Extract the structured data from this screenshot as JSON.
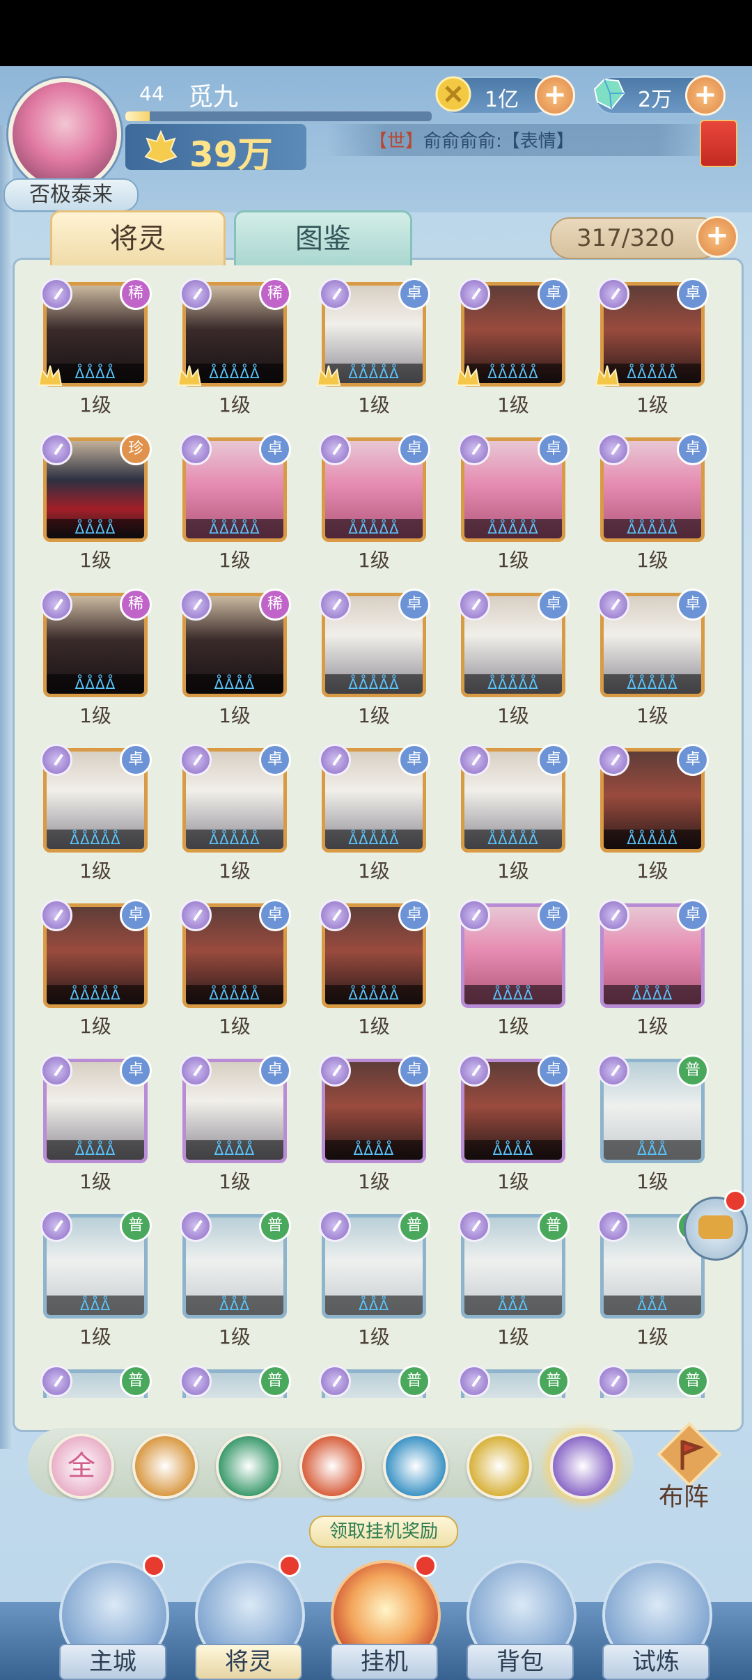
{
  "player": {
    "level": "44",
    "name": "觅九",
    "title": "否极泰来",
    "power": "39万",
    "exp_progress": 0.08
  },
  "resources": {
    "gold": "1亿",
    "gem": "2万"
  },
  "chat": {
    "channel": "【世】",
    "text": "俞俞俞俞:【表情】"
  },
  "tabs": [
    {
      "label": "将灵",
      "active": true
    },
    {
      "label": "图鉴",
      "active": false
    }
  ],
  "capacity": "317/320",
  "cards": [
    {
      "rarity": "稀",
      "rclass": "rare",
      "frame": "gold",
      "tone": "dark",
      "stars": "ᐂᐂᐂᐂ",
      "level": "1级",
      "crown": true
    },
    {
      "rarity": "稀",
      "rclass": "rare",
      "frame": "gold",
      "tone": "dark",
      "stars": "ᐂᐂᐂᐂᐂ",
      "level": "1级",
      "crown": true
    },
    {
      "rarity": "卓",
      "rclass": "elite",
      "frame": "gold",
      "tone": "white",
      "stars": "ᐂᐂᐂᐂᐂ",
      "level": "1级",
      "crown": true
    },
    {
      "rarity": "卓",
      "rclass": "elite",
      "frame": "gold",
      "tone": "red",
      "stars": "ᐂᐂᐂᐂᐂ",
      "level": "1级",
      "crown": true
    },
    {
      "rarity": "卓",
      "rclass": "elite",
      "frame": "gold",
      "tone": "red",
      "stars": "ᐂᐂᐂᐂᐂ",
      "level": "1级",
      "crown": true
    },
    {
      "rarity": "珍",
      "rclass": "precious",
      "frame": "gold",
      "tone": "ninja",
      "stars": "ᐂᐂᐂᐂ",
      "level": "1级",
      "crown": false
    },
    {
      "rarity": "卓",
      "rclass": "elite",
      "frame": "gold",
      "tone": "pink",
      "stars": "ᐂᐂᐂᐂᐂ",
      "level": "1级",
      "crown": false
    },
    {
      "rarity": "卓",
      "rclass": "elite",
      "frame": "gold",
      "tone": "pink",
      "stars": "ᐂᐂᐂᐂᐂ",
      "level": "1级",
      "crown": false
    },
    {
      "rarity": "卓",
      "rclass": "elite",
      "frame": "gold",
      "tone": "pink",
      "stars": "ᐂᐂᐂᐂᐂ",
      "level": "1级",
      "crown": false
    },
    {
      "rarity": "卓",
      "rclass": "elite",
      "frame": "gold",
      "tone": "pink",
      "stars": "ᐂᐂᐂᐂᐂ",
      "level": "1级",
      "crown": false
    },
    {
      "rarity": "稀",
      "rclass": "rare",
      "frame": "gold",
      "tone": "dark",
      "stars": "ᐂᐂᐂᐂ",
      "level": "1级",
      "crown": false
    },
    {
      "rarity": "稀",
      "rclass": "rare",
      "frame": "gold",
      "tone": "dark",
      "stars": "ᐂᐂᐂᐂ",
      "level": "1级",
      "crown": false
    },
    {
      "rarity": "卓",
      "rclass": "elite",
      "frame": "gold",
      "tone": "white",
      "stars": "ᐂᐂᐂᐂᐂ",
      "level": "1级",
      "crown": false
    },
    {
      "rarity": "卓",
      "rclass": "elite",
      "frame": "gold",
      "tone": "white",
      "stars": "ᐂᐂᐂᐂᐂ",
      "level": "1级",
      "crown": false
    },
    {
      "rarity": "卓",
      "rclass": "elite",
      "frame": "gold",
      "tone": "white",
      "stars": "ᐂᐂᐂᐂᐂ",
      "level": "1级",
      "crown": false
    },
    {
      "rarity": "卓",
      "rclass": "elite",
      "frame": "gold",
      "tone": "white",
      "stars": "ᐂᐂᐂᐂᐂ",
      "level": "1级",
      "crown": false
    },
    {
      "rarity": "卓",
      "rclass": "elite",
      "frame": "gold",
      "tone": "white",
      "stars": "ᐂᐂᐂᐂᐂ",
      "level": "1级",
      "crown": false
    },
    {
      "rarity": "卓",
      "rclass": "elite",
      "frame": "gold",
      "tone": "white",
      "stars": "ᐂᐂᐂᐂᐂ",
      "level": "1级",
      "crown": false
    },
    {
      "rarity": "卓",
      "rclass": "elite",
      "frame": "gold",
      "tone": "white",
      "stars": "ᐂᐂᐂᐂᐂ",
      "level": "1级",
      "crown": false
    },
    {
      "rarity": "卓",
      "rclass": "elite",
      "frame": "gold",
      "tone": "red",
      "stars": "ᐂᐂᐂᐂᐂ",
      "level": "1级",
      "crown": false
    },
    {
      "rarity": "卓",
      "rclass": "elite",
      "frame": "gold",
      "tone": "red",
      "stars": "ᐂᐂᐂᐂᐂ",
      "level": "1级",
      "crown": false
    },
    {
      "rarity": "卓",
      "rclass": "elite",
      "frame": "gold",
      "tone": "red",
      "stars": "ᐂᐂᐂᐂᐂ",
      "level": "1级",
      "crown": false
    },
    {
      "rarity": "卓",
      "rclass": "elite",
      "frame": "gold",
      "tone": "red",
      "stars": "ᐂᐂᐂᐂᐂ",
      "level": "1级",
      "crown": false
    },
    {
      "rarity": "卓",
      "rclass": "elite",
      "frame": "purple",
      "tone": "pink",
      "stars": "ᐂᐂᐂᐂ",
      "level": "1级",
      "crown": false
    },
    {
      "rarity": "卓",
      "rclass": "elite",
      "frame": "purple",
      "tone": "pink",
      "stars": "ᐂᐂᐂᐂ",
      "level": "1级",
      "crown": false
    },
    {
      "rarity": "卓",
      "rclass": "elite",
      "frame": "purple",
      "tone": "white",
      "stars": "ᐂᐂᐂᐂ",
      "level": "1级",
      "crown": false
    },
    {
      "rarity": "卓",
      "rclass": "elite",
      "frame": "purple",
      "tone": "white",
      "stars": "ᐂᐂᐂᐂ",
      "level": "1级",
      "crown": false
    },
    {
      "rarity": "卓",
      "rclass": "elite",
      "frame": "purple",
      "tone": "red",
      "stars": "ᐂᐂᐂᐂ",
      "level": "1级",
      "crown": false
    },
    {
      "rarity": "卓",
      "rclass": "elite",
      "frame": "purple",
      "tone": "red",
      "stars": "ᐂᐂᐂᐂ",
      "level": "1级",
      "crown": false
    },
    {
      "rarity": "普",
      "rclass": "common",
      "frame": "blue",
      "tone": "pale",
      "stars": "ᐂᐂᐂ",
      "level": "1级",
      "crown": false
    },
    {
      "rarity": "普",
      "rclass": "common",
      "frame": "blue",
      "tone": "pale",
      "stars": "ᐂᐂᐂ",
      "level": "1级",
      "crown": false
    },
    {
      "rarity": "普",
      "rclass": "common",
      "frame": "blue",
      "tone": "pale",
      "stars": "ᐂᐂᐂ",
      "level": "1级",
      "crown": false
    },
    {
      "rarity": "普",
      "rclass": "common",
      "frame": "blue",
      "tone": "pale",
      "stars": "ᐂᐂᐂ",
      "level": "1级",
      "crown": false
    },
    {
      "rarity": "普",
      "rclass": "common",
      "frame": "blue",
      "tone": "pale",
      "stars": "ᐂᐂᐂ",
      "level": "1级",
      "crown": false
    },
    {
      "rarity": "普",
      "rclass": "common",
      "frame": "blue",
      "tone": "pale",
      "stars": "ᐂᐂᐂ",
      "level": "1级",
      "crown": false
    },
    {
      "rarity": "普",
      "rclass": "common",
      "frame": "blue",
      "tone": "pale",
      "stars": "",
      "level": "",
      "crown": false
    },
    {
      "rarity": "普",
      "rclass": "common",
      "frame": "blue",
      "tone": "pale",
      "stars": "",
      "level": "",
      "crown": false
    },
    {
      "rarity": "普",
      "rclass": "common",
      "frame": "blue",
      "tone": "pale",
      "stars": "",
      "level": "",
      "crown": false
    },
    {
      "rarity": "普",
      "rclass": "common",
      "frame": "blue",
      "tone": "pale",
      "stars": "",
      "level": "",
      "crown": false
    },
    {
      "rarity": "普",
      "rclass": "common",
      "frame": "blue",
      "tone": "pale",
      "stars": "",
      "level": "",
      "crown": false
    }
  ],
  "filters": [
    {
      "name": "filter-all",
      "label": "全",
      "color": "#e9b0c8"
    },
    {
      "name": "filter-mountain",
      "label": "",
      "color": "#d99a45"
    },
    {
      "name": "filter-wind",
      "label": "",
      "color": "#3d9b6e"
    },
    {
      "name": "filter-fire",
      "label": "",
      "color": "#d8613f"
    },
    {
      "name": "filter-water",
      "label": "",
      "color": "#3e94c6"
    },
    {
      "name": "filter-light",
      "label": "",
      "color": "#d8b23c"
    },
    {
      "name": "filter-dark",
      "label": "",
      "color": "#8c6ac8"
    }
  ],
  "deploy_label": "布阵",
  "idle_reward": "领取挂机奖励",
  "nav": [
    {
      "name": "nav-main-city",
      "label": "主城",
      "dot": true,
      "active": false
    },
    {
      "name": "nav-spirits",
      "label": "将灵",
      "dot": true,
      "active": true
    },
    {
      "name": "nav-idle",
      "label": "挂机",
      "dot": true,
      "active": false
    },
    {
      "name": "nav-bag",
      "label": "背包",
      "dot": false,
      "active": false
    },
    {
      "name": "nav-trial",
      "label": "试炼",
      "dot": false,
      "active": false
    }
  ]
}
